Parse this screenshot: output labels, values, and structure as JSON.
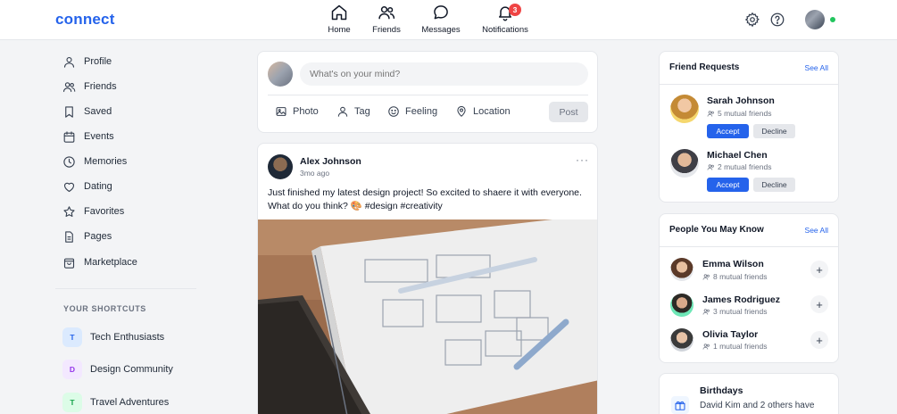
{
  "app": {
    "logo": "connect"
  },
  "nav": [
    {
      "label": "Home",
      "icon": "home-icon"
    },
    {
      "label": "Friends",
      "icon": "friends-icon"
    },
    {
      "label": "Messages",
      "icon": "messages-icon"
    },
    {
      "label": "Notifications",
      "icon": "bell-icon",
      "badge": "3"
    }
  ],
  "sidebar": {
    "items": [
      {
        "label": "Profile",
        "icon": "user-icon"
      },
      {
        "label": "Friends",
        "icon": "users-icon"
      },
      {
        "label": "Saved",
        "icon": "bookmark-icon"
      },
      {
        "label": "Events",
        "icon": "calendar-icon"
      },
      {
        "label": "Memories",
        "icon": "clock-icon"
      },
      {
        "label": "Dating",
        "icon": "heart-icon"
      },
      {
        "label": "Favorites",
        "icon": "star-icon"
      },
      {
        "label": "Pages",
        "icon": "page-icon"
      },
      {
        "label": "Marketplace",
        "icon": "shopping-bag-icon"
      }
    ],
    "shortcuts_heading": "YOUR SHORTCUTS",
    "shortcuts": [
      {
        "initial": "T",
        "label": "Tech Enthusiasts",
        "color": "#dbeafe",
        "text_color": "#2563eb"
      },
      {
        "initial": "D",
        "label": "Design Community",
        "color": "#f3e8ff",
        "text_color": "#9333ea"
      },
      {
        "initial": "T",
        "label": "Travel Adventures",
        "color": "#dcfce7",
        "text_color": "#16a34a"
      }
    ]
  },
  "composer": {
    "placeholder": "What's on your mind?",
    "actions": [
      {
        "label": "Photo",
        "icon": "image-icon"
      },
      {
        "label": "Tag",
        "icon": "tag-user-icon"
      },
      {
        "label": "Feeling",
        "icon": "smile-icon"
      },
      {
        "label": "Location",
        "icon": "map-pin-icon"
      }
    ],
    "post_label": "Post"
  },
  "post": {
    "author": "Alex Johnson",
    "time": "3mo ago",
    "more": "···",
    "text": "Just finished my latest design project! So excited to shaere it with everyone. What do you think? 🎨 #design #creativity"
  },
  "friend_requests": {
    "title": "Friend Requests",
    "see_all": "See All",
    "items": [
      {
        "name": "Sarah Johnson",
        "mutual": "5 mutual friends"
      },
      {
        "name": "Michael Chen",
        "mutual": "2 mutual friends"
      }
    ],
    "accept": "Accept",
    "decline": "Decline"
  },
  "people_you_may_know": {
    "title": "People You May Know",
    "see_all": "See All",
    "items": [
      {
        "name": "Emma Wilson",
        "mutual": "8 mutual friends"
      },
      {
        "name": "James Rodriguez",
        "mutual": "3 mutual friends"
      },
      {
        "name": "Olivia Taylor",
        "mutual": "1 mutual friends"
      }
    ],
    "add": "+"
  },
  "birthdays": {
    "title": "Birthdays",
    "text": "David Kim and 2 others have"
  },
  "colors": {
    "accent": "#2563eb",
    "online": "#22c55e",
    "badge": "#ef4444"
  }
}
